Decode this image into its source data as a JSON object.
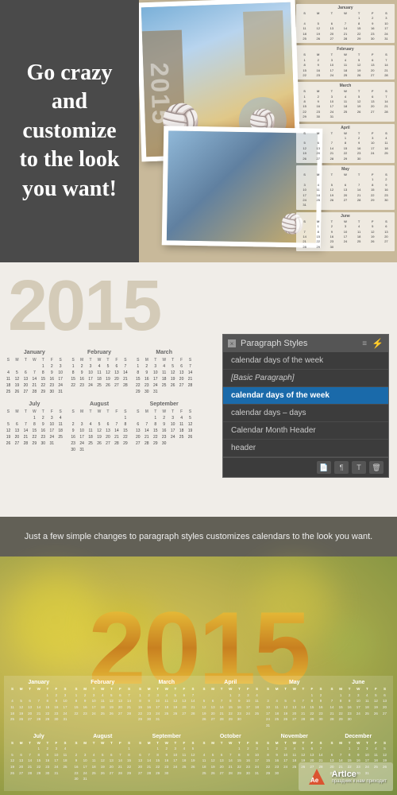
{
  "section_top": {
    "headline": "Go crazy and customize to the look you want!",
    "year": "2015"
  },
  "section_middle": {
    "year": "2015",
    "calendar": {
      "rows": [
        [
          "January",
          "February",
          "March"
        ],
        [
          "July",
          "August",
          "September"
        ]
      ]
    },
    "panel": {
      "title": "Paragraph Styles",
      "items": [
        {
          "label": "calendar days of the week",
          "selected": false,
          "italic": false
        },
        {
          "label": "[Basic Paragraph]",
          "selected": false,
          "italic": true
        },
        {
          "label": "calendar days of the week",
          "selected": true,
          "italic": false
        },
        {
          "label": "calendar days – days",
          "selected": false,
          "italic": false
        },
        {
          "label": "Calendar Month Header",
          "selected": false,
          "italic": false
        },
        {
          "label": "header",
          "selected": false,
          "italic": false
        }
      ]
    }
  },
  "section_bottom": {
    "banner_text": "Just a few simple changes to paragraph styles customizes calendars to the look you want.",
    "year": "2015",
    "calendar_months_row1": [
      "January",
      "February",
      "March",
      "April",
      "May",
      "June"
    ],
    "calendar_months_row2": [
      "July",
      "August",
      "September",
      "October",
      "November",
      "December"
    ]
  },
  "watermark": {
    "logo": "ArtIce",
    "subtext": "праздник к нам приходит"
  }
}
